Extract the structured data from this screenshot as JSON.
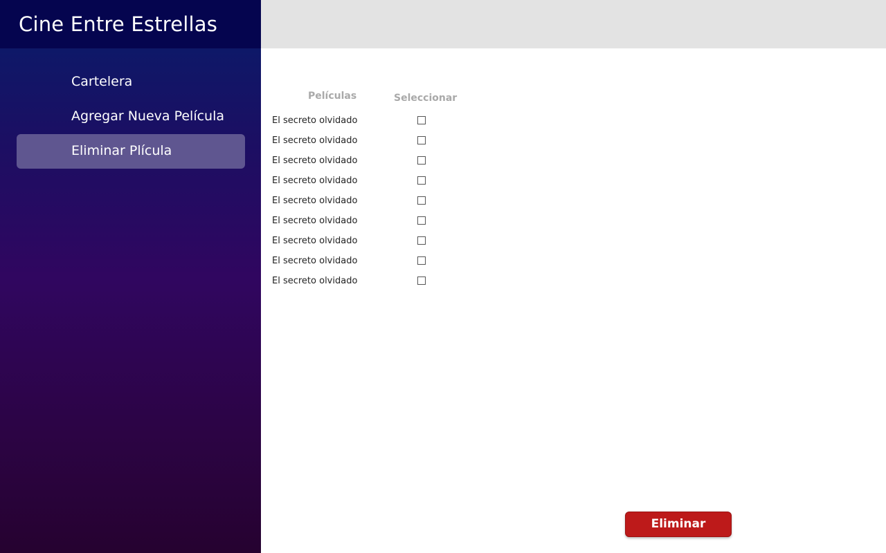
{
  "app": {
    "title": "Cine Entre Estrellas"
  },
  "sidebar": {
    "items": [
      {
        "label": "Cartelera",
        "active": false
      },
      {
        "label": "Agregar Nueva Película",
        "active": false
      },
      {
        "label": "Eliminar Plícula",
        "active": true
      }
    ]
  },
  "table": {
    "headers": {
      "movies": "Películas",
      "select": "Seleccionar"
    },
    "rows": [
      {
        "title": "El secreto olvidado",
        "selected": false
      },
      {
        "title": "El secreto olvidado",
        "selected": false
      },
      {
        "title": "El secreto olvidado",
        "selected": false
      },
      {
        "title": "El secreto olvidado",
        "selected": false
      },
      {
        "title": "El secreto olvidado",
        "selected": false
      },
      {
        "title": "El secreto olvidado",
        "selected": false
      },
      {
        "title": "El secreto olvidado",
        "selected": false
      },
      {
        "title": "El secreto olvidado",
        "selected": false
      },
      {
        "title": "El secreto olvidado",
        "selected": false
      }
    ]
  },
  "actions": {
    "delete_label": "Eliminar"
  },
  "colors": {
    "sidebar_header": "#05054f",
    "sidebar_active": "#5f5690",
    "topbar": "#e3e3e3",
    "delete_button": "#bd1a1a"
  }
}
